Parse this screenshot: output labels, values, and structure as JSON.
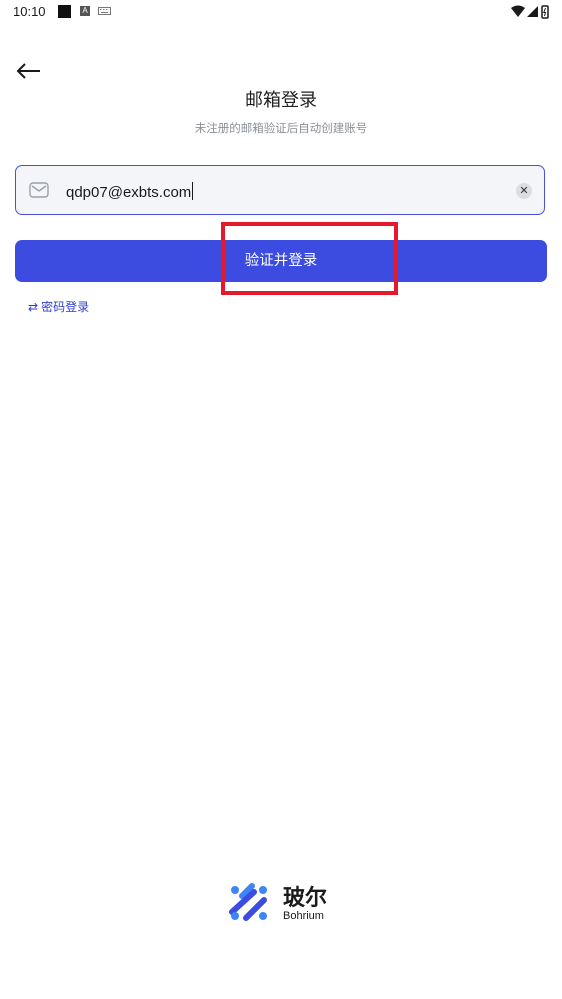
{
  "status_bar": {
    "time": "10:10",
    "notif_a": "A"
  },
  "header": {
    "title": "邮箱登录",
    "subtitle": "未注册的邮箱验证后自动创建账号"
  },
  "email_input": {
    "value": "qdp07@exbts.com",
    "clear_symbol": "✕"
  },
  "submit_button": {
    "label": "验证并登录",
    "color": "#3d4ce0"
  },
  "highlight": {
    "color": "#e5192b"
  },
  "switch_login": {
    "icon": "⇄",
    "label": "密码登录"
  },
  "footer": {
    "brand_cn": "玻尔",
    "brand_en": "Bohrium"
  },
  "icons": [
    "back-arrow-icon",
    "mail-icon",
    "clear-icon",
    "swap-icon",
    "wifi-icon",
    "signal-icon",
    "battery-icon",
    "bohrium-logo-icon"
  ]
}
